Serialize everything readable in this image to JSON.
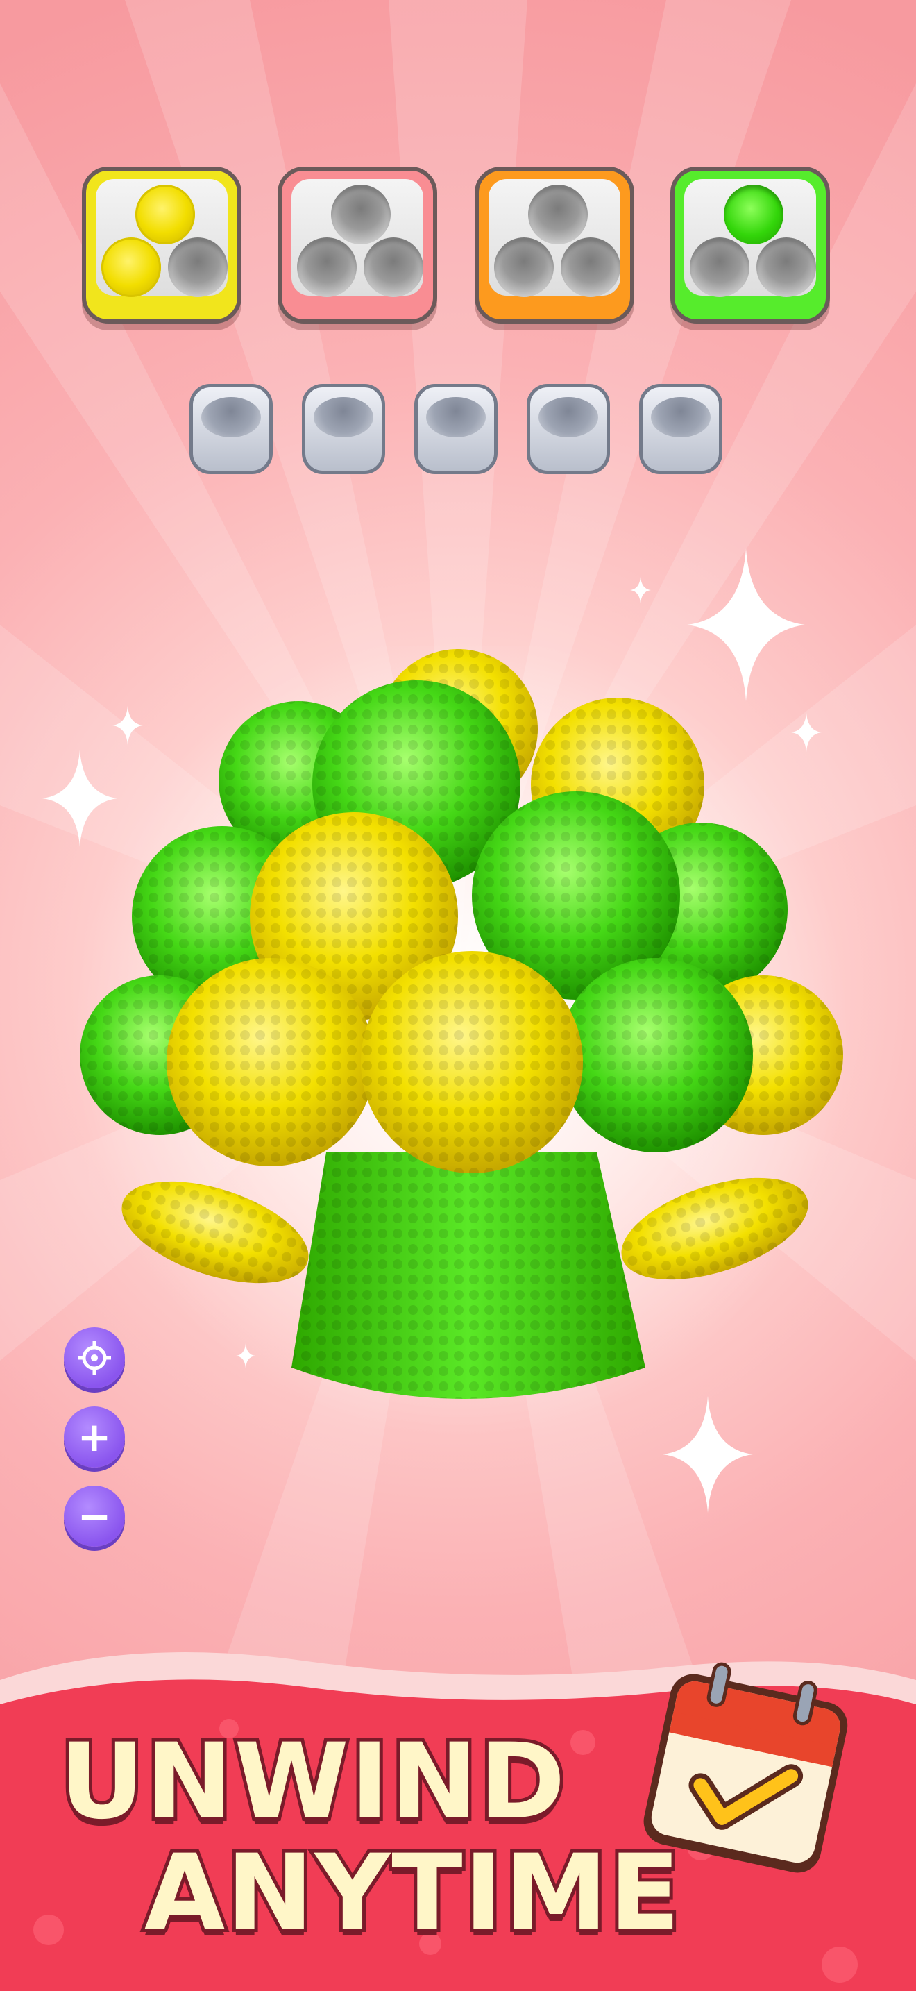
{
  "trays": [
    {
      "color": "#f1e51c",
      "filled": 2,
      "fill_color": "yellow"
    },
    {
      "color": "#f98d93",
      "filled": 0,
      "fill_color": "none"
    },
    {
      "color": "#fd9a1e",
      "filled": 0,
      "fill_color": "none"
    },
    {
      "color": "#56ec2c",
      "filled": 1,
      "fill_color": "green"
    }
  ],
  "holding_cups": {
    "count": 5,
    "filled": 0
  },
  "controls": [
    {
      "name": "recenter-button",
      "icon": "crosshair-icon",
      "glyph": "⌖"
    },
    {
      "name": "zoom-in-button",
      "icon": "plus-icon",
      "glyph": "+"
    },
    {
      "name": "zoom-out-button",
      "icon": "minus-icon",
      "glyph": "−"
    }
  ],
  "banner": {
    "line1": "UNWIND",
    "line2": "ANYTIME",
    "badge_icon": "calendar-check-icon"
  },
  "colors": {
    "background": "#f7a0a6",
    "yellow": "#f2de00",
    "green": "#3dd50d",
    "accent": "#8a55ee"
  }
}
